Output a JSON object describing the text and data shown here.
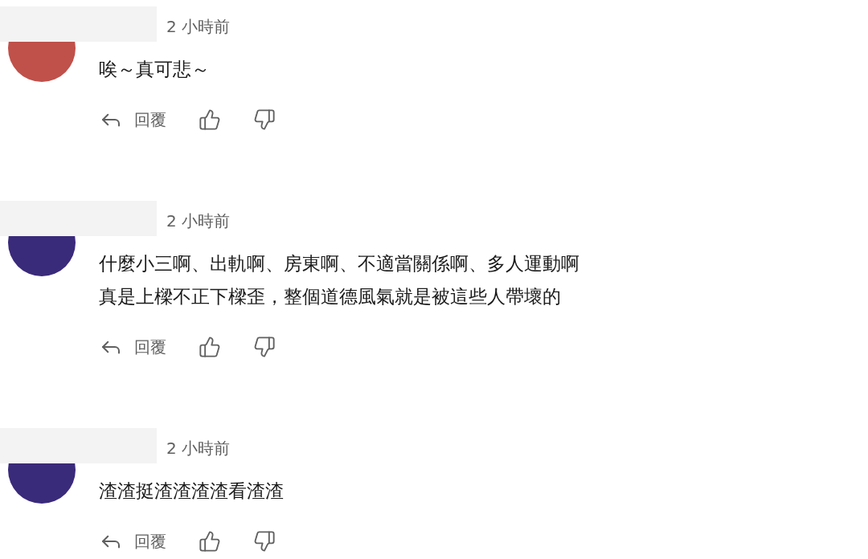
{
  "comments": [
    {
      "avatar": {
        "color": "#c0504a"
      },
      "time": "2 小時前",
      "lines": [
        "唉～真可悲～"
      ],
      "reply_label": "回覆"
    },
    {
      "avatar": {
        "color": "#3a2a7a"
      },
      "time": "2 小時前",
      "lines": [
        "什麼小三啊、出軌啊、房東啊、不適當關係啊、多人運動啊",
        "真是上樑不正下樑歪，整個道德風氣就是被這些人帶壞的"
      ],
      "reply_label": "回覆"
    },
    {
      "avatar": {
        "color": "#3a2a7a"
      },
      "time": "2 小時前",
      "lines": [
        "渣渣挺渣渣渣渣看渣渣"
      ],
      "reply_label": "回覆"
    }
  ]
}
